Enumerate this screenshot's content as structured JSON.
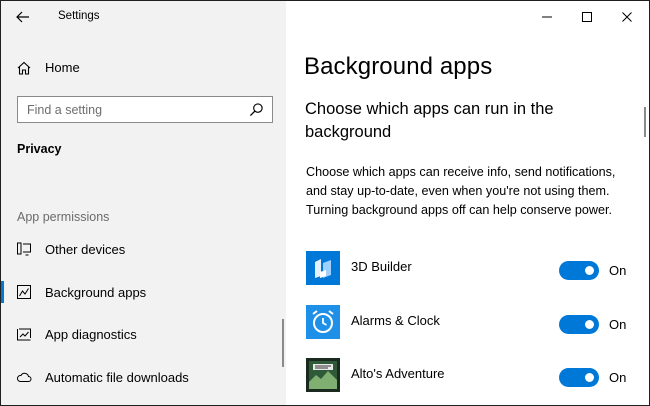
{
  "window": {
    "title": "Settings"
  },
  "sidebar": {
    "home_label": "Home",
    "search_placeholder": "Find a setting",
    "section_title": "Privacy",
    "group_label": "App permissions",
    "items": [
      {
        "label": "Other devices",
        "icon": "devices-icon",
        "selected": false
      },
      {
        "label": "Background apps",
        "icon": "background-apps-icon",
        "selected": true
      },
      {
        "label": "App diagnostics",
        "icon": "diagnostics-icon",
        "selected": false
      },
      {
        "label": "Automatic file downloads",
        "icon": "cloud-icon",
        "selected": false
      }
    ]
  },
  "main": {
    "title": "Background apps",
    "subheading": "Choose which apps can run in the background",
    "description": "Choose which apps can receive info, send notifications, and stay up-to-date, even when you're not using them. Turning background apps off can help conserve power.",
    "apps": [
      {
        "name": "3D Builder",
        "state": "On",
        "icon": "3d-builder-icon"
      },
      {
        "name": "Alarms & Clock",
        "state": "On",
        "icon": "alarm-clock-icon"
      },
      {
        "name": "Alto's Adventure",
        "state": "On",
        "icon": "altos-adventure-icon"
      }
    ]
  },
  "colors": {
    "accent": "#0078d7",
    "sidebar_bg": "#f2f2f2"
  }
}
